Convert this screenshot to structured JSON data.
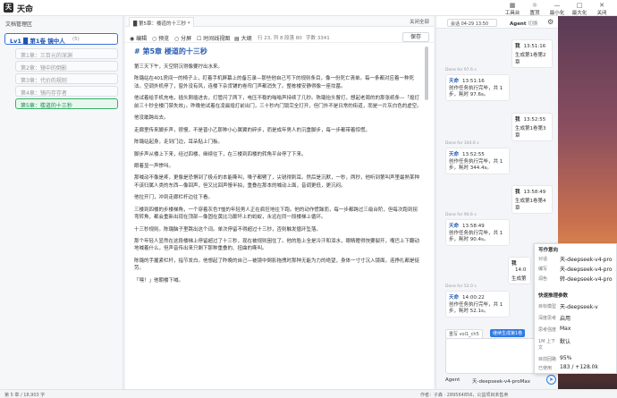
{
  "app": {
    "title": "天命",
    "logo_char": "天"
  },
  "titlebar": {
    "buttons": [
      {
        "icon": "workbench-icon",
        "label": "工具台"
      },
      {
        "icon": "sun-icon",
        "label": "置顶"
      },
      {
        "icon": "minimize-icon",
        "label": "最小化"
      },
      {
        "icon": "maximize-icon",
        "label": "最大化"
      },
      {
        "icon": "close-icon",
        "label": "关闭"
      }
    ]
  },
  "sidebar": {
    "header": "文档管理区",
    "volume": {
      "label": "Lv1 █ 第1卷 镜中人",
      "count": "(5)"
    },
    "chapters": [
      "第1章：三百元的深渊",
      "第2章：镜中的倒影",
      "第3章：代价的规则",
      "第4章：镜内存存者",
      "第5章：楼道的十三秒"
    ]
  },
  "tabs": {
    "active": "█ 第5章：楼道的十三秒 *",
    "close_all": "关闭全部"
  },
  "toolbar": {
    "modes": [
      "编辑",
      "预览",
      "分屏"
    ],
    "timeline": "时间线视图",
    "outline": "大纲",
    "stats": [
      "行 23, 列 8",
      "段落 80",
      "字数 3341"
    ],
    "save": "保存"
  },
  "doc": {
    "title": "# 第5章 楼道的十三秒",
    "paragraphs": [
      "第三天下午，天空阴沉得像要拧出水来。",
      "陈璐站在401房间一的椅子上，盯着手机屏幕上的备忘录—那些他自己写下的规则条目，像一份死亡清单。每一条都对应着一种死法。空调外机停了，窗外没有风，连楼下杂货铺的卷帘门声都消失了。整栋楼安静得像一座坟墓。",
      "他试着给手机充电，插头刚插进去，灯管闪了两下，电压不稳的嗡嗡声持续了几秒。陈璐抬头瞥灯，想起老周的的那张纸条—「熄灯前三十秒全楼门禁失效」。昨晚他试着在凌晨熄灯前出门，三十秒内门锁完全打开，但门外不是日常的街道，而是一片灰白色的虚空。",
      "他没敢跨出去。",
      "走廊里传来脚步声，很慢，不是普小乙那种小心翼翼的碎步，而是成年男人的沉重脚步，每一步都带着惊慌。",
      "陈璐站起身，走到门边，耳朵贴上门板。",
      "脚步声从楼上下来，经过四楼，继续往下，在三楼到四楼的转角平台停了下来。",
      "眼着显一声惨叫。",
      "那喊动不像是疼，更像是恐惧到了极点的本能嘶叫，嗓子都劈了，尖锐得刺耳。然后是沉默，一秒，两秒，他听到第叫声里最熟某种不该归属人类的东西—像回声，但又比回声慢半拍，重叠在那本的喊动上面，音调更低，更沉闷。",
      "他拉开门，冲到走廊栏杆边往下看。",
      "三楼到四楼的步楼梯角，一个穿着灰色T恤的年轻男人正在疯狂地往下跑。他的动作慌躁而，每一步都跨过三级台阶，但每次跑到拐弯转角，都会重新出现在顶部—像固在黄比马厮坏上的蚂蚁，永远在同一段楼梯上循环。",
      "十三秒规则。陈璐脑子里跳出这个词。单次停留不得超过十三秒，否则触发循环坠落。",
      "那个年轻人显然在这段楼梯上停留超过了十三秒，现在被规则困住了。他的脸上全是冷汗和泪水，眼睛瞪得快要裂开，嘴巴上下翻动地喊着什么，但声音传出来只剩下那种重叠的、扭曲的嘶叫。",
      "陈璐的手握紧栏杆，指节发白。他想起了昨晚的自己—被镜中倒影拖拽时那种无能为力的绝望，身体一寸寸沉入镜面，连挣扎都是徒劳。",
      "「嘿！」他朝楼下喊。"
    ]
  },
  "agent": {
    "session": "会话 04-29 13:50",
    "agent_label": "Agent",
    "agent_sub": "切换",
    "messages": [
      {
        "role": "me",
        "name": "我",
        "time": "13:51:16",
        "text": "生成第1卷第2章"
      },
      {
        "role": "ai",
        "done": "Done for 97.6 s",
        "name": "天命",
        "time": "13:51:16",
        "text": "创作任务执行完毕，共 1 步，耗时 97.6s。"
      },
      {
        "role": "me",
        "name": "我",
        "time": "13:52:55",
        "text": "生成第1卷第3章"
      },
      {
        "role": "ai",
        "done": "Done for 344.6 s",
        "name": "天命",
        "time": "13:52:55",
        "text": "创作任务执行完毕，共 1 步，耗时 344.4s。"
      },
      {
        "role": "me",
        "name": "我",
        "time": "13:58:49",
        "text": "生成第1卷第4章"
      },
      {
        "role": "ai",
        "done": "Done for 90.6 s",
        "name": "天命",
        "time": "13:58:49",
        "text": "创作任务执行完毕，共 1 步，耗时 90.4s。"
      },
      {
        "role": "me",
        "name": "我",
        "time": "14:0",
        "text": "生成第"
      },
      {
        "role": "ai",
        "done": "Done for 52.0 s",
        "name": "天命",
        "time": "14:00:22",
        "text": "创作任务执行完毕，共 1 步，耗时 52.1s。"
      }
    ],
    "chips": [
      "重写 vol1_ch5",
      "继续生成第1卷"
    ],
    "mode": "Agent",
    "model": "天-deepseek-v4-proMax"
  },
  "menu": {
    "title": "写作意向",
    "rows": [
      {
        "k": "对话",
        "v": "天-deepseek-v4-pro"
      },
      {
        "k": "编写",
        "v": "天-deepseek-v4-pro"
      },
      {
        "k": "润色",
        "v": "转-deepseek-v4-pro"
      }
    ],
    "section": "快速推理参数",
    "params": [
      {
        "k": "目标模型",
        "v": "天-deepseek-v"
      },
      {
        "k": "深度思考",
        "v": "启用"
      },
      {
        "k": "思考强度",
        "v": "Max"
      },
      {
        "k": "1M 上下文",
        "v": "默认"
      }
    ],
    "context_label": "目前回路",
    "context_val": "95%",
    "context_used_label": "已使用",
    "context_used": "183 / +128.0k"
  },
  "statusbar": {
    "left": "第 5 章 / 18,903 字",
    "right": "作者：子森 · 289564856，公益项目未售卖"
  }
}
